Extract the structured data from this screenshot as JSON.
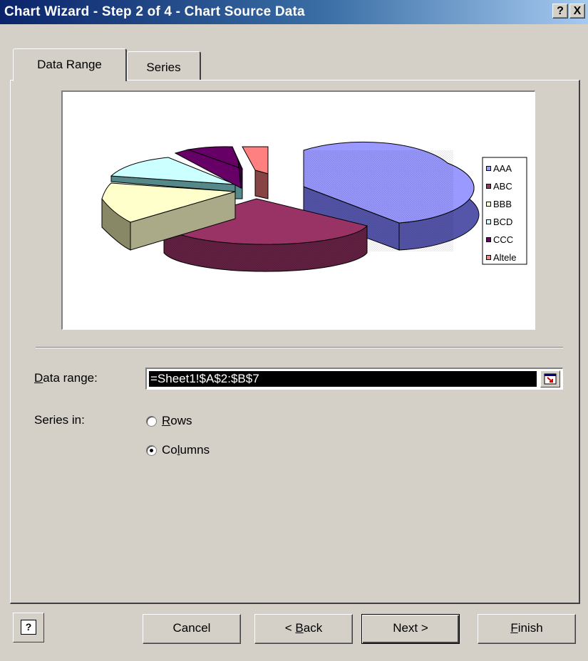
{
  "window": {
    "title": "Chart Wizard - Step 2 of 4 - Chart Source Data",
    "help_glyph": "?",
    "close_glyph": "X"
  },
  "tabs": [
    {
      "label": "Data Range",
      "active": true
    },
    {
      "label": "Series",
      "active": false
    }
  ],
  "preview": {
    "chart_type": "pie-3d-exploded",
    "legend": [
      {
        "label": "AAA",
        "color": "#9999ff"
      },
      {
        "label": "ABC",
        "color": "#993366"
      },
      {
        "label": "BBB",
        "color": "#ffffcc"
      },
      {
        "label": "BCD",
        "color": "#ccffff"
      },
      {
        "label": "CCC",
        "color": "#660066"
      },
      {
        "label": "Altele",
        "color": "#ff8080"
      }
    ]
  },
  "form": {
    "data_range_label_pre": "",
    "data_range_label_u": "D",
    "data_range_label_post": "ata range:",
    "data_range_value": "=Sheet1!$A$2:$B$7",
    "series_in_label": "Series in:",
    "rows_label_u": "R",
    "rows_label_post": "ows",
    "columns_label_pre": "Co",
    "columns_label_u": "l",
    "columns_label_post": "umns",
    "selected": "Columns"
  },
  "buttons": {
    "cancel": "Cancel",
    "back_pre": "< ",
    "back_u": "B",
    "back_post": "ack",
    "next": "Next >",
    "finish_u": "F",
    "finish_post": "inish",
    "help_glyph": "?"
  }
}
